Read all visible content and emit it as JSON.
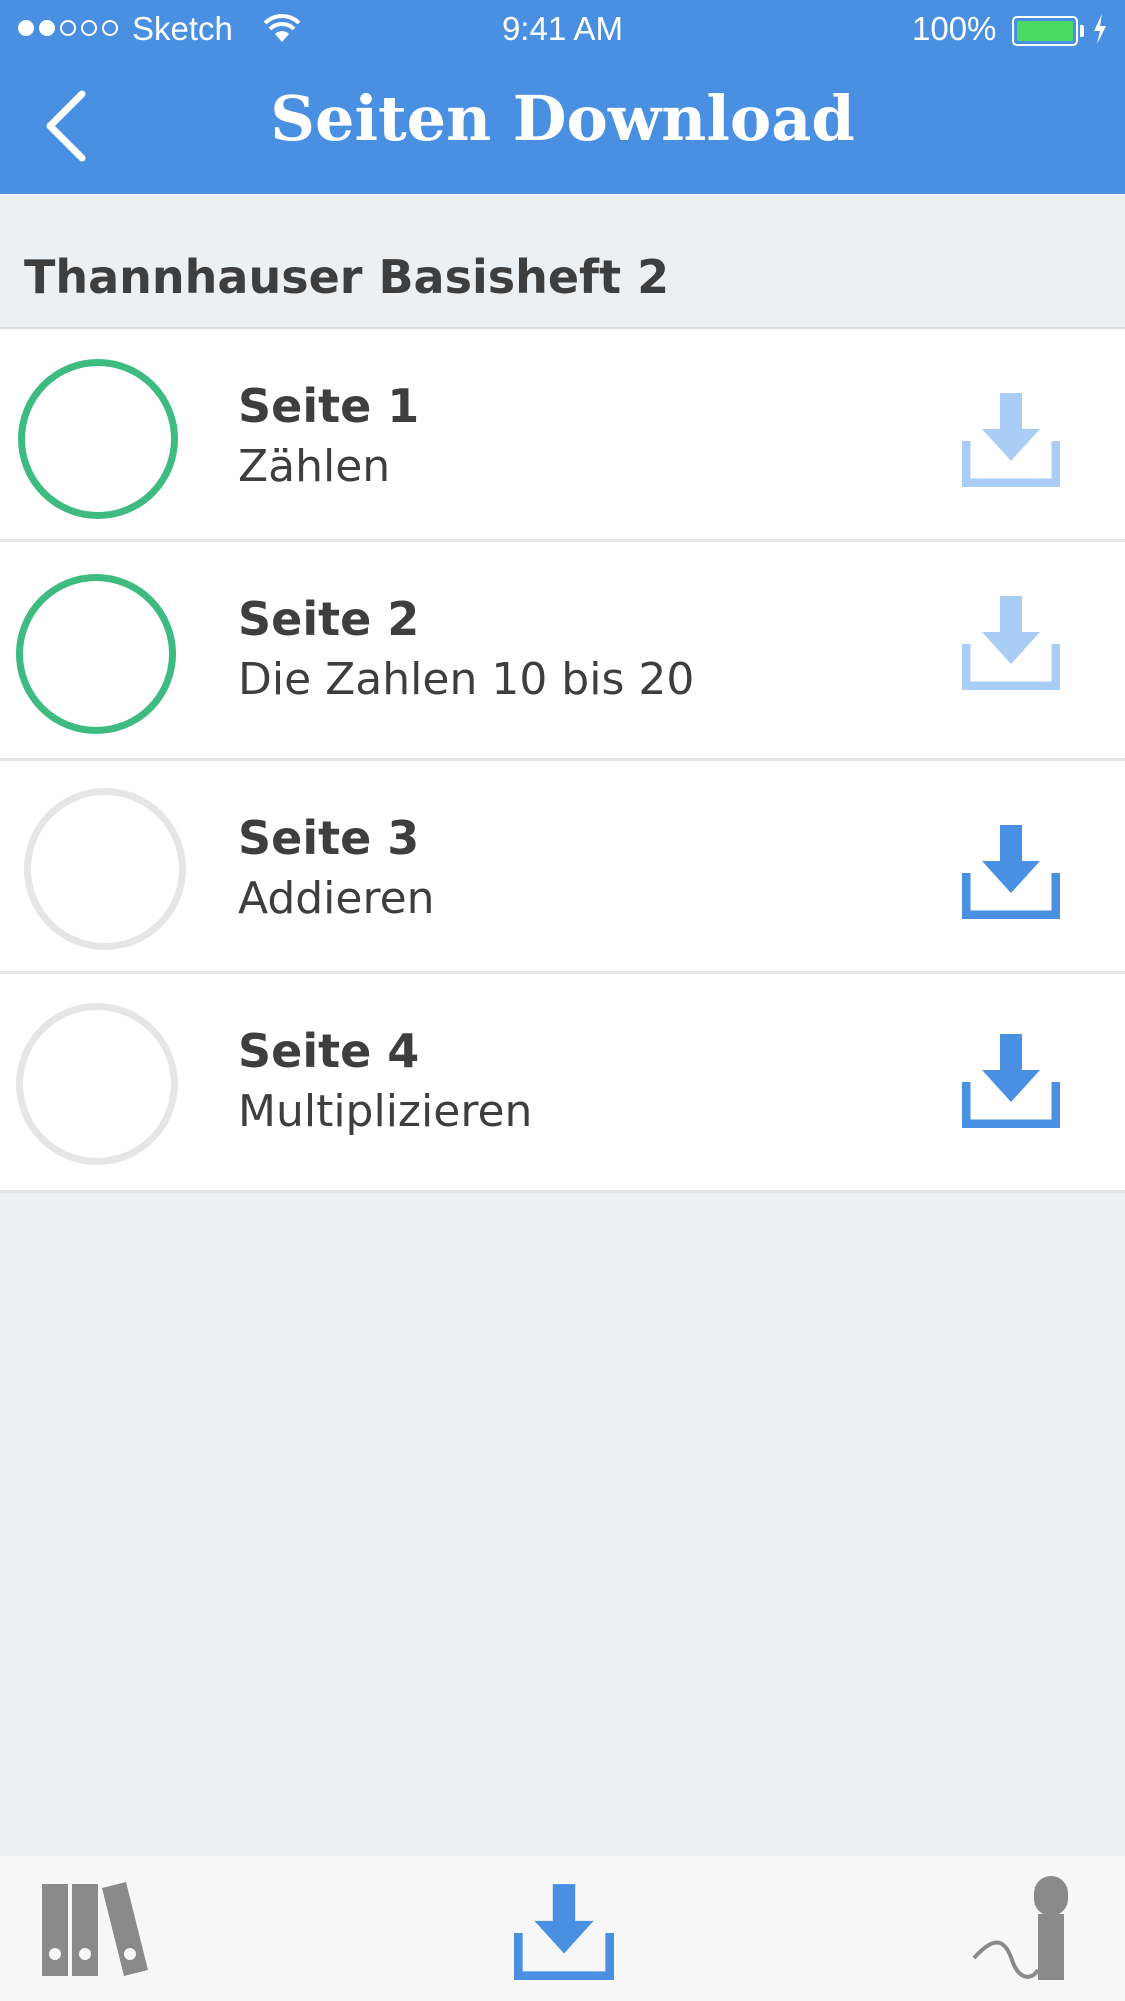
{
  "status_bar": {
    "carrier": "Sketch",
    "time": "9:41 AM",
    "battery": "100%"
  },
  "nav": {
    "title": "Seiten Download",
    "back_icon": "chevron-left-icon"
  },
  "section": {
    "title": "Thannhauser Basisheft 2"
  },
  "pages": [
    {
      "title": "Seite 1",
      "subtitle": "Zählen",
      "downloaded": true
    },
    {
      "title": "Seite 2",
      "subtitle": "Die Zahlen 10 bis 20",
      "downloaded": true
    },
    {
      "title": "Seite 3",
      "subtitle": "Addieren",
      "downloaded": false
    },
    {
      "title": "Seite 4",
      "subtitle": "Multiplizieren",
      "downloaded": false
    }
  ],
  "colors": {
    "brand": "#4a90e2",
    "download_active": "#4a90e2",
    "download_disabled": "#a9cdf5",
    "done_ring": "#3dbb81",
    "pending_ring": "#e6e6e6"
  },
  "tabbar": {
    "items": [
      {
        "icon": "library-icon"
      },
      {
        "icon": "download-icon",
        "active": true
      },
      {
        "icon": "microphone-icon"
      }
    ]
  }
}
